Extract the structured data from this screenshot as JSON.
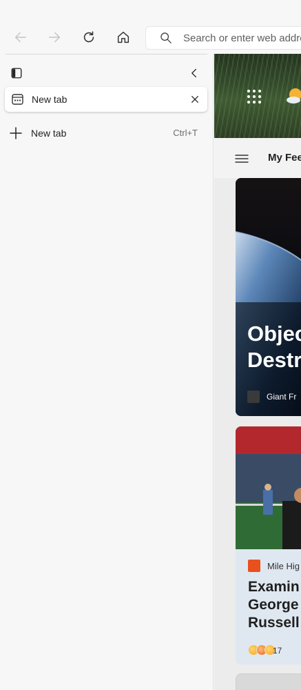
{
  "toolbar": {
    "address_placeholder": "Search or enter web address"
  },
  "sidebar": {
    "tabs": [
      {
        "title": "New tab"
      }
    ],
    "new_tab": {
      "label": "New tab",
      "shortcut": "Ctrl+T"
    }
  },
  "page": {
    "feed_title": "My Feed",
    "cards": [
      {
        "headline": "Objec\nDestr",
        "source": "Giant Fr"
      },
      {
        "source": "Mile Hig",
        "headline_lines": [
          "Examin",
          "George",
          "Russell"
        ],
        "reaction_count": "17"
      }
    ]
  },
  "colors": {
    "accent": "#0067c0",
    "sidebar_bg": "#f7f7f7",
    "tab_bg": "#ffffff"
  },
  "icons": {
    "back": "arrow-left-icon",
    "forward": "arrow-right-icon",
    "refresh": "refresh-icon",
    "home": "home-icon",
    "search": "search-icon",
    "tab_actions": "tab-actions-icon",
    "collapse": "chevron-left-icon",
    "favicon": "newtab-favicon-icon",
    "close": "close-icon",
    "plus": "plus-icon",
    "apps": "app-launcher-icon",
    "weather": "weather-icon",
    "menu": "hamburger-icon"
  }
}
